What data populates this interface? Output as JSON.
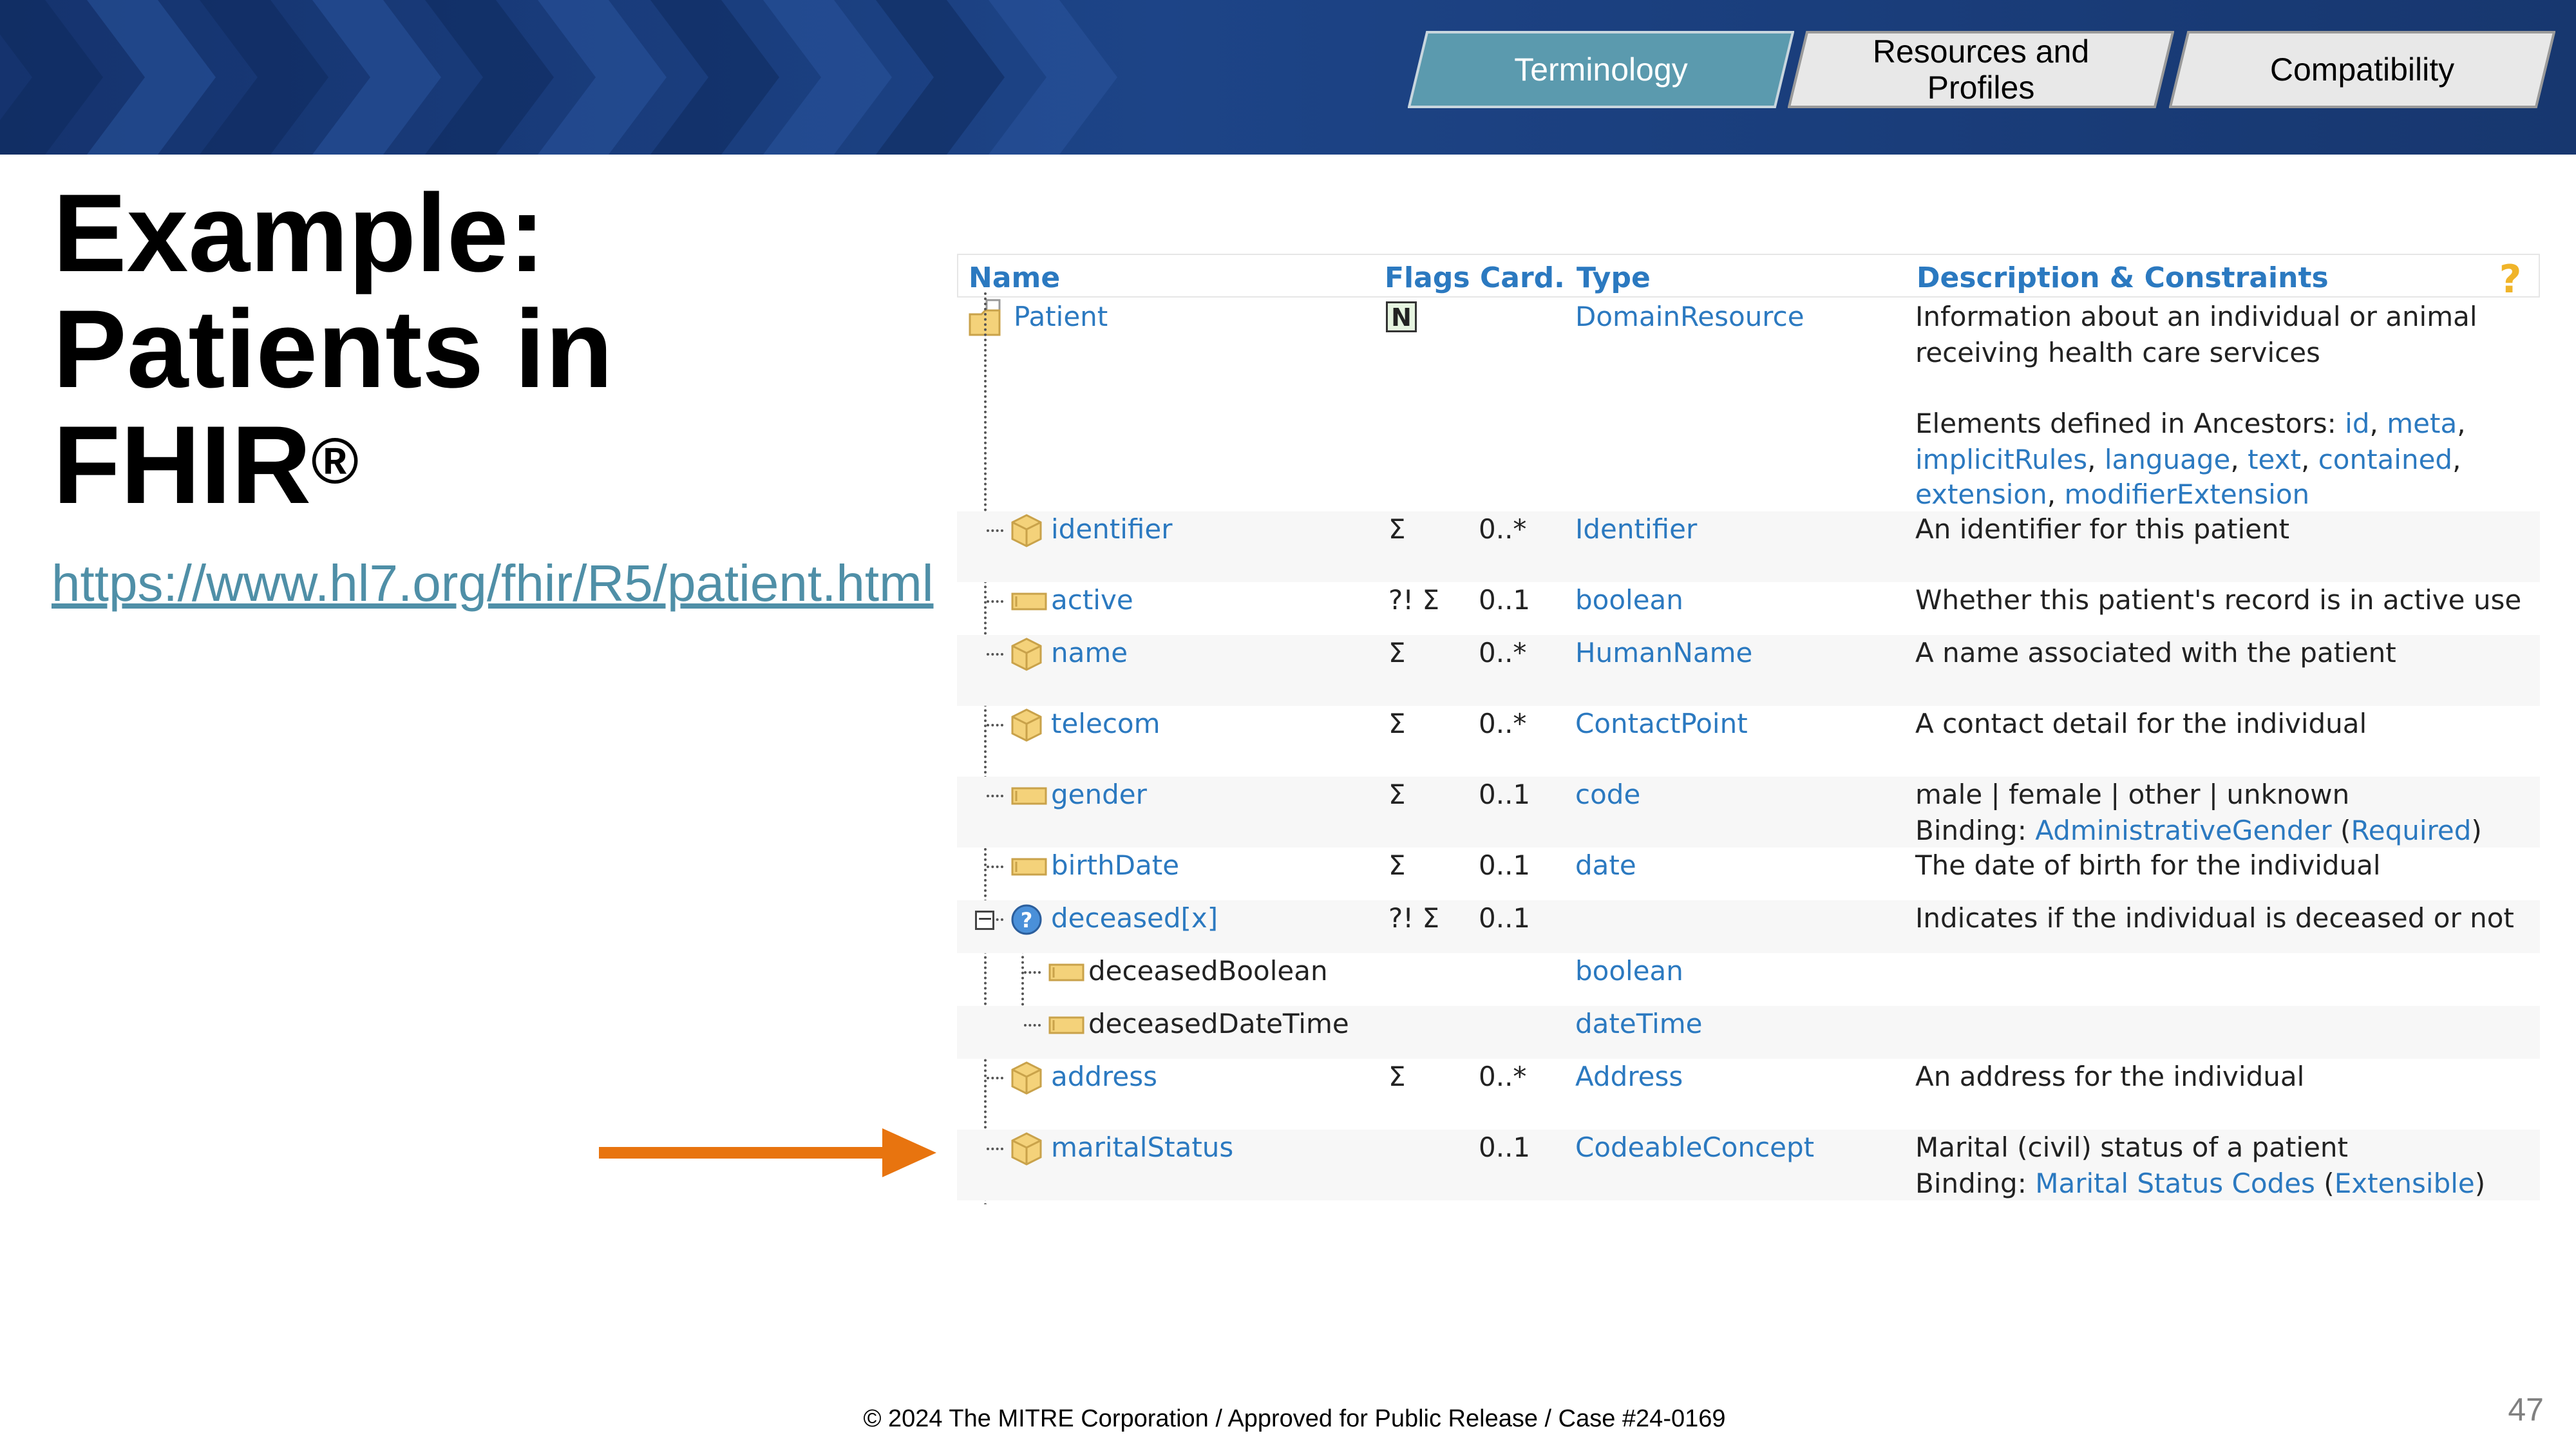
{
  "tabs": [
    {
      "label": "Terminology",
      "active": true
    },
    {
      "label": "Resources and Profiles",
      "active": false
    },
    {
      "label": "Compatibility",
      "active": false
    }
  ],
  "title_lines": [
    "Example:",
    "Patients in",
    "FHIR"
  ],
  "title_mark": "®",
  "url": "https://www.hl7.org/fhir/R5/patient.html",
  "table": {
    "headers": {
      "name": "Name",
      "flags": "Flags",
      "card": "Card.",
      "type": "Type",
      "desc": "Description & Constraints"
    },
    "root": {
      "name": "Patient",
      "flag": "N",
      "type": "DomainResource",
      "desc1": "Information about an individual or animal",
      "desc2": "receiving health care services",
      "ancestors_prefix": "Elements defined in Ancestors:",
      "ancestors": [
        "id",
        "meta",
        "implicitRules",
        "language",
        "text",
        "contained",
        "extension",
        "modifierExtension"
      ]
    },
    "rows": [
      {
        "name": "identifier",
        "flags": "Σ",
        "card": "0..*",
        "type": "Identifier",
        "desc": "An identifier for this patient"
      },
      {
        "name": "active",
        "flags": "?! Σ",
        "card": "0..1",
        "type": "boolean",
        "desc": "Whether this patient's record is in active use"
      },
      {
        "name": "name",
        "flags": "Σ",
        "card": "0..*",
        "type": "HumanName",
        "desc": "A name associated with the patient"
      },
      {
        "name": "telecom",
        "flags": "Σ",
        "card": "0..*",
        "type": "ContactPoint",
        "desc": "A contact detail for the individual"
      },
      {
        "name": "gender",
        "flags": "Σ",
        "card": "0..1",
        "type": "code",
        "desc": "male | female | other | unknown",
        "binding_prefix": "Binding:",
        "binding": "AdministrativeGender",
        "strength": "Required"
      },
      {
        "name": "birthDate",
        "flags": "Σ",
        "card": "0..1",
        "type": "date",
        "desc": "The date of birth for the individual"
      },
      {
        "name": "deceased[x]",
        "flags": "?! Σ",
        "card": "0..1",
        "type": "",
        "desc": "Indicates if the individual is deceased or not"
      },
      {
        "name": "deceasedBoolean",
        "flags": "",
        "card": "",
        "type": "boolean",
        "desc": ""
      },
      {
        "name": "deceasedDateTime",
        "flags": "",
        "card": "",
        "type": "dateTime",
        "desc": ""
      },
      {
        "name": "address",
        "flags": "Σ",
        "card": "0..*",
        "type": "Address",
        "desc": "An address for the individual"
      },
      {
        "name": "maritalStatus",
        "flags": "",
        "card": "0..1",
        "type": "CodeableConcept",
        "desc": "Marital (civil) status of a patient",
        "binding_prefix": "Binding:",
        "binding": "Marital Status Codes",
        "strength": "Extensible"
      }
    ]
  },
  "footer": "© 2024 The MITRE Corporation / Approved for Public Release / Case #24-0169",
  "page_number": "47",
  "colors": {
    "accent_tab": "#5b9aae",
    "link": "#2b79c0",
    "arrow": "#e8740f",
    "url": "#4f8fa7"
  }
}
